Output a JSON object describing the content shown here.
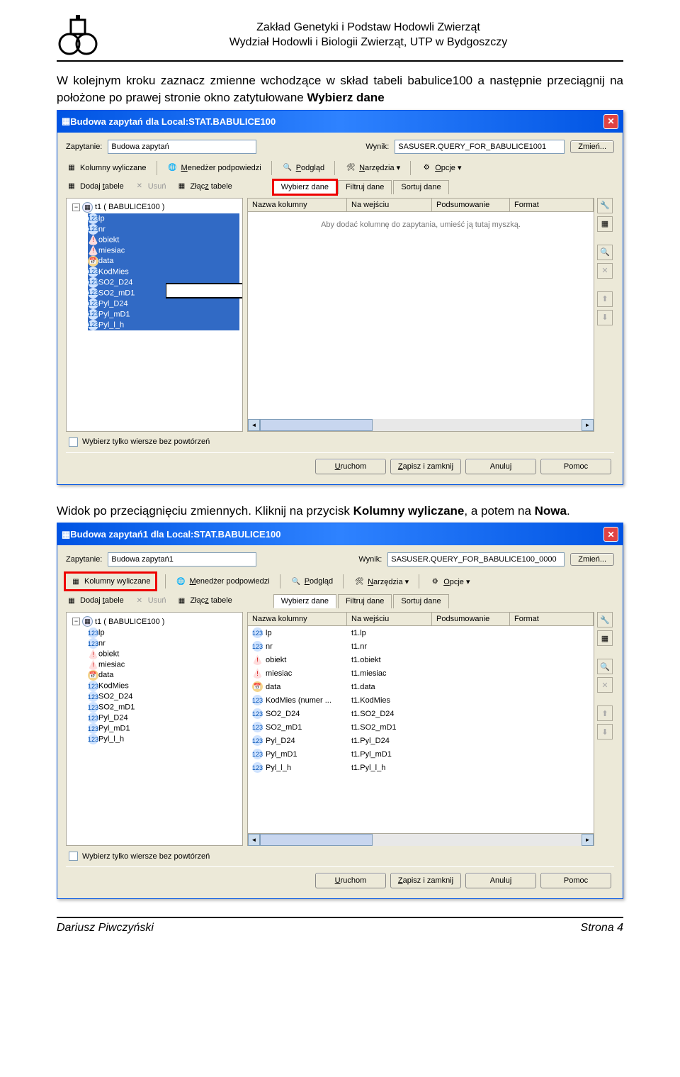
{
  "header": {
    "line1": "Zakład Genetyki i Podstaw Hodowli Zwierząt",
    "line2": "Wydział Hodowli i Biologii Zwierząt, UTP w Bydgoszczy"
  },
  "para1_pre": "W kolejnym kroku zaznacz zmienne wchodzące w skład tabeli babulice100 a następnie przeciągnij na położone po prawej stronie okno zatytułowane ",
  "para1_bold": "Wybierz dane",
  "para2_pre": "Widok po przeciągnięciu zmiennych. Kliknij na przycisk ",
  "para2_bold1": "Kolumny wyliczane",
  "para2_mid": ", a potem na ",
  "para2_bold2": "Nowa",
  "para2_end": ".",
  "win1": {
    "title": "Budowa zapytań dla Local:STAT.BABULICE100",
    "label_zapytanie": "Zapytanie:",
    "val_zapytanie": "Budowa zapytań",
    "label_wynik": "Wynik:",
    "val_wynik": "SASUSER.QUERY_FOR_BABULICE1001",
    "btn_zmien": "Zmień...",
    "tb": {
      "kolumny": "Kolumny wyliczane",
      "menedzer": "Menedżer podpowiedzi",
      "podglad": "Podgląd",
      "narzedzia": "Narzędzia",
      "opcje": "Opcje",
      "dodaj": "Dodaj tabele",
      "usun": "Usuń",
      "zlacz": "Złącz tabele"
    },
    "tabs": {
      "wybierz": "Wybierz dane",
      "filtruj": "Filtruj dane",
      "sortuj": "Sortuj dane"
    },
    "tree_root": "t1 ( BABULICE100 )",
    "tree_items": [
      "lp",
      "nr",
      "obiekt",
      "miesiac",
      "data",
      "KodMies",
      "SO2_D24",
      "SO2_mD1",
      "Pyl_D24",
      "Pyl_mD1",
      "Pyl_l_h"
    ],
    "grid_headers": {
      "c1": "Nazwa kolumny",
      "c2": "Na wejściu",
      "c3": "Podsumowanie",
      "c4": "Format"
    },
    "placeholder": "Aby dodać kolumnę do zapytania, umieść ją tutaj myszką.",
    "checkbox": "Wybierz tylko wiersze bez powtórzeń",
    "btns": {
      "uruchom": "Uruchom",
      "zapisz": "Zapisz i zamknij",
      "anuluj": "Anuluj",
      "pomoc": "Pomoc"
    }
  },
  "win2": {
    "title": "Budowa zapytań1 dla Local:STAT.BABULICE100",
    "label_zapytanie": "Zapytanie:",
    "val_zapytanie": "Budowa zapytań1",
    "label_wynik": "Wynik:",
    "val_wynik": "SASUSER.QUERY_FOR_BABULICE100_0000",
    "btn_zmien": "Zmień...",
    "tb": {
      "kolumny": "Kolumny wyliczane",
      "menedzer": "Menedżer podpowiedzi",
      "podglad": "Podgląd",
      "narzedzia": "Narzędzia",
      "opcje": "Opcje",
      "dodaj": "Dodaj tabele",
      "usun": "Usuń",
      "zlacz": "Złącz tabele"
    },
    "tabs": {
      "wybierz": "Wybierz dane",
      "filtruj": "Filtruj dane",
      "sortuj": "Sortuj dane"
    },
    "tree_root": "t1 ( BABULICE100 )",
    "tree_items": [
      "lp",
      "nr",
      "obiekt",
      "miesiac",
      "data",
      "KodMies",
      "SO2_D24",
      "SO2_mD1",
      "Pyl_D24",
      "Pyl_mD1",
      "Pyl_l_h"
    ],
    "grid_headers": {
      "c1": "Nazwa kolumny",
      "c2": "Na wejściu",
      "c3": "Podsumowanie",
      "c4": "Format"
    },
    "grid_rows": [
      {
        "c1": "lp",
        "c2": "t1.lp",
        "icon": "num"
      },
      {
        "c1": "nr",
        "c2": "t1.nr",
        "icon": "num"
      },
      {
        "c1": "obiekt",
        "c2": "t1.obiekt",
        "icon": "tri"
      },
      {
        "c1": "miesiac",
        "c2": "t1.miesiac",
        "icon": "tri"
      },
      {
        "c1": "data",
        "c2": "t1.data",
        "icon": "cal"
      },
      {
        "c1": "KodMies (numer ...",
        "c2": "t1.KodMies",
        "icon": "num"
      },
      {
        "c1": "SO2_D24",
        "c2": "t1.SO2_D24",
        "icon": "num"
      },
      {
        "c1": "SO2_mD1",
        "c2": "t1.SO2_mD1",
        "icon": "num"
      },
      {
        "c1": "Pyl_D24",
        "c2": "t1.Pyl_D24",
        "icon": "num"
      },
      {
        "c1": "Pyl_mD1",
        "c2": "t1.Pyl_mD1",
        "icon": "num"
      },
      {
        "c1": "Pyl_l_h",
        "c2": "t1.Pyl_l_h",
        "icon": "num"
      }
    ],
    "checkbox": "Wybierz tylko wiersze bez powtórzeń",
    "btns": {
      "uruchom": "Uruchom",
      "zapisz": "Zapisz i zamknij",
      "anuluj": "Anuluj",
      "pomoc": "Pomoc"
    }
  },
  "footer": {
    "author": "Dariusz Piwczyński",
    "page": "Strona 4"
  }
}
